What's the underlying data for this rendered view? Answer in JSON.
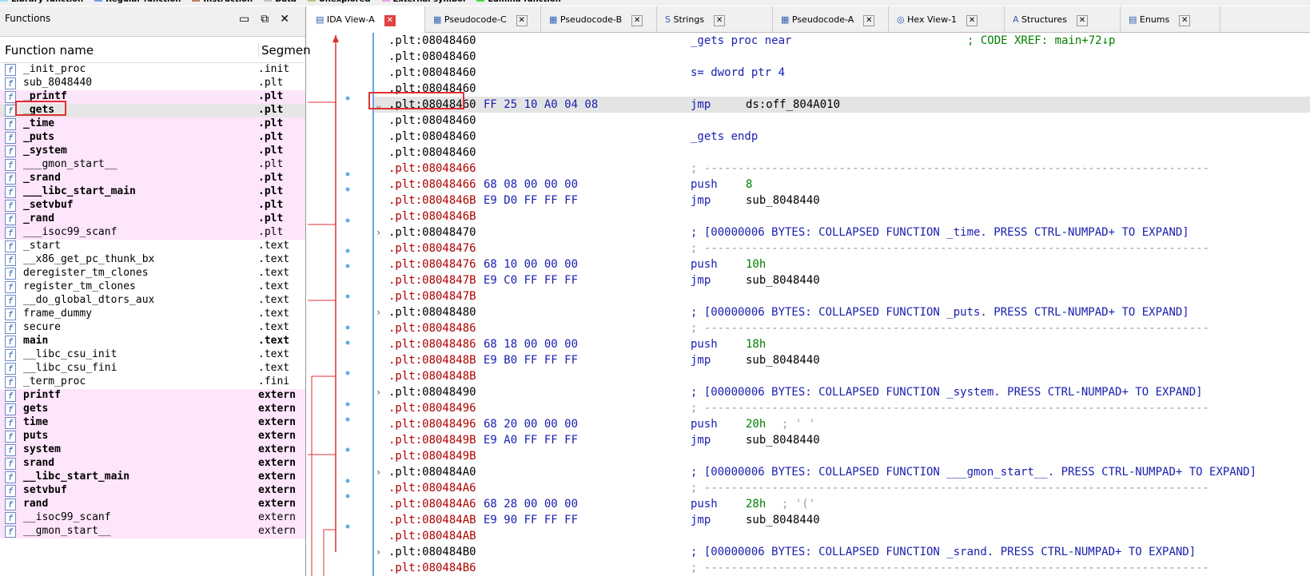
{
  "legend": [
    {
      "c": "#a0e0f0",
      "t": "Library function"
    },
    {
      "c": "#6aa0e0",
      "t": "Regular function"
    },
    {
      "c": "#c08060",
      "t": "Instruction"
    },
    {
      "c": "#c0c0c0",
      "t": "Data"
    },
    {
      "c": "#c0c080",
      "t": "Unexplored"
    },
    {
      "c": "#f0a0f0",
      "t": "External symbol"
    },
    {
      "c": "#40e040",
      "t": "Lumina function"
    }
  ],
  "functions_panel": {
    "title": "Functions",
    "col_name": "Function name",
    "col_seg": "Segmen",
    "rows": [
      {
        "n": "_init_proc",
        "s": ".init",
        "p": 0,
        "b": 0
      },
      {
        "n": "sub_8048440",
        "s": ".plt",
        "p": 0,
        "b": 0
      },
      {
        "n": "_printf",
        "s": ".plt",
        "p": 1,
        "b": 1
      },
      {
        "n": "_gets",
        "s": ".plt",
        "p": 1,
        "b": 1,
        "sel": 1
      },
      {
        "n": "_time",
        "s": ".plt",
        "p": 1,
        "b": 1
      },
      {
        "n": "_puts",
        "s": ".plt",
        "p": 1,
        "b": 1
      },
      {
        "n": "_system",
        "s": ".plt",
        "p": 1,
        "b": 1
      },
      {
        "n": "___gmon_start__",
        "s": ".plt",
        "p": 1,
        "b": 0
      },
      {
        "n": "_srand",
        "s": ".plt",
        "p": 1,
        "b": 1
      },
      {
        "n": "___libc_start_main",
        "s": ".plt",
        "p": 1,
        "b": 1
      },
      {
        "n": "_setvbuf",
        "s": ".plt",
        "p": 1,
        "b": 1
      },
      {
        "n": "_rand",
        "s": ".plt",
        "p": 1,
        "b": 1
      },
      {
        "n": "___isoc99_scanf",
        "s": ".plt",
        "p": 1,
        "b": 0
      },
      {
        "n": "_start",
        "s": ".text",
        "p": 0,
        "b": 0
      },
      {
        "n": "__x86_get_pc_thunk_bx",
        "s": ".text",
        "p": 0,
        "b": 0
      },
      {
        "n": "deregister_tm_clones",
        "s": ".text",
        "p": 0,
        "b": 0
      },
      {
        "n": "register_tm_clones",
        "s": ".text",
        "p": 0,
        "b": 0
      },
      {
        "n": "__do_global_dtors_aux",
        "s": ".text",
        "p": 0,
        "b": 0
      },
      {
        "n": "frame_dummy",
        "s": ".text",
        "p": 0,
        "b": 0
      },
      {
        "n": "secure",
        "s": ".text",
        "p": 0,
        "b": 0
      },
      {
        "n": "main",
        "s": ".text",
        "p": 0,
        "b": 1
      },
      {
        "n": "__libc_csu_init",
        "s": ".text",
        "p": 0,
        "b": 0
      },
      {
        "n": "__libc_csu_fini",
        "s": ".text",
        "p": 0,
        "b": 0
      },
      {
        "n": "_term_proc",
        "s": ".fini",
        "p": 0,
        "b": 0
      },
      {
        "n": "printf",
        "s": "extern",
        "p": 1,
        "b": 1
      },
      {
        "n": "gets",
        "s": "extern",
        "p": 1,
        "b": 1
      },
      {
        "n": "time",
        "s": "extern",
        "p": 1,
        "b": 1
      },
      {
        "n": "puts",
        "s": "extern",
        "p": 1,
        "b": 1
      },
      {
        "n": "system",
        "s": "extern",
        "p": 1,
        "b": 1
      },
      {
        "n": "srand",
        "s": "extern",
        "p": 1,
        "b": 1
      },
      {
        "n": "__libc_start_main",
        "s": "extern",
        "p": 1,
        "b": 1
      },
      {
        "n": "setvbuf",
        "s": "extern",
        "p": 1,
        "b": 1
      },
      {
        "n": "rand",
        "s": "extern",
        "p": 1,
        "b": 1
      },
      {
        "n": "__isoc99_scanf",
        "s": "extern",
        "p": 1,
        "b": 0
      },
      {
        "n": "__gmon_start__",
        "s": "extern",
        "p": 1,
        "b": 0
      }
    ]
  },
  "tabs": [
    "IDA View-A",
    "Pseudocode-C",
    "Pseudocode-B",
    "Strings",
    "Pseudocode-A",
    "Hex View-1",
    "Structures",
    "Enums"
  ],
  "lines": [
    {
      "a": ".plt:08048460",
      "k": "b",
      "c": "_gets proc near",
      "x": "; CODE XREF: main+72↓p"
    },
    {
      "a": ".plt:08048460",
      "k": "b"
    },
    {
      "a": ".plt:08048460",
      "k": "b",
      "c": "s= dword ptr  4"
    },
    {
      "a": ".plt:08048460",
      "k": "b"
    },
    {
      "a": ".plt:08048460",
      "k": "b",
      "by": "FF 25 10 A0 04 08",
      "i": "jmp",
      "o": "ds:off_804A010",
      "hl": 1,
      "e": "⌄"
    },
    {
      "a": ".plt:08048460",
      "k": "b"
    },
    {
      "a": ".plt:08048460",
      "k": "b",
      "c": "_gets endp"
    },
    {
      "a": ".plt:08048460",
      "k": "b"
    },
    {
      "a": ".plt:08048466",
      "k": "r",
      "d": "; ---------------------------------------------------------------------------"
    },
    {
      "a": ".plt:08048466",
      "k": "r",
      "by": "68 08 00 00 00",
      "i": "push",
      "o": "8"
    },
    {
      "a": ".plt:0804846B",
      "k": "r",
      "by": "E9 D0 FF FF FF",
      "i": "jmp",
      "o": "sub_8048440"
    },
    {
      "a": ".plt:0804846B",
      "k": "r"
    },
    {
      "a": ".plt:08048470",
      "k": "b",
      "d": "; [00000006 BYTES: COLLAPSED FUNCTION _time. PRESS CTRL-NUMPAD+ TO EXPAND]",
      "e": "›"
    },
    {
      "a": ".plt:08048476",
      "k": "r",
      "d": "; ---------------------------------------------------------------------------"
    },
    {
      "a": ".plt:08048476",
      "k": "r",
      "by": "68 10 00 00 00",
      "i": "push",
      "o": "10h"
    },
    {
      "a": ".plt:0804847B",
      "k": "r",
      "by": "E9 C0 FF FF FF",
      "i": "jmp",
      "o": "sub_8048440"
    },
    {
      "a": ".plt:0804847B",
      "k": "r"
    },
    {
      "a": ".plt:08048480",
      "k": "b",
      "d": "; [00000006 BYTES: COLLAPSED FUNCTION _puts. PRESS CTRL-NUMPAD+ TO EXPAND]",
      "e": "›"
    },
    {
      "a": ".plt:08048486",
      "k": "r",
      "d": "; ---------------------------------------------------------------------------"
    },
    {
      "a": ".plt:08048486",
      "k": "r",
      "by": "68 18 00 00 00",
      "i": "push",
      "o": "18h"
    },
    {
      "a": ".plt:0804848B",
      "k": "r",
      "by": "E9 B0 FF FF FF",
      "i": "jmp",
      "o": "sub_8048440"
    },
    {
      "a": ".plt:0804848B",
      "k": "r"
    },
    {
      "a": ".plt:08048490",
      "k": "b",
      "d": "; [00000006 BYTES: COLLAPSED FUNCTION _system. PRESS CTRL-NUMPAD+ TO EXPAND]",
      "e": "›"
    },
    {
      "a": ".plt:08048496",
      "k": "r",
      "d": "; ---------------------------------------------------------------------------"
    },
    {
      "a": ".plt:08048496",
      "k": "r",
      "by": "68 20 00 00 00",
      "i": "push",
      "o": "20h",
      "oc": "; ' '"
    },
    {
      "a": ".plt:0804849B",
      "k": "r",
      "by": "E9 A0 FF FF FF",
      "i": "jmp",
      "o": "sub_8048440"
    },
    {
      "a": ".plt:0804849B",
      "k": "r"
    },
    {
      "a": ".plt:080484A0",
      "k": "b",
      "d": "; [00000006 BYTES: COLLAPSED FUNCTION ___gmon_start__. PRESS CTRL-NUMPAD+ TO EXPAND]",
      "e": "›"
    },
    {
      "a": ".plt:080484A6",
      "k": "r",
      "d": "; ---------------------------------------------------------------------------"
    },
    {
      "a": ".plt:080484A6",
      "k": "r",
      "by": "68 28 00 00 00",
      "i": "push",
      "o": "28h",
      "oc": "; '('"
    },
    {
      "a": ".plt:080484AB",
      "k": "r",
      "by": "E9 90 FF FF FF",
      "i": "jmp",
      "o": "sub_8048440"
    },
    {
      "a": ".plt:080484AB",
      "k": "r"
    },
    {
      "a": ".plt:080484B0",
      "k": "b",
      "d": "; [00000006 BYTES: COLLAPSED FUNCTION _srand. PRESS CTRL-NUMPAD+ TO EXPAND]",
      "e": "›"
    },
    {
      "a": ".plt:080484B6",
      "k": "r",
      "d": "; ---------------------------------------------------------------------------"
    }
  ]
}
